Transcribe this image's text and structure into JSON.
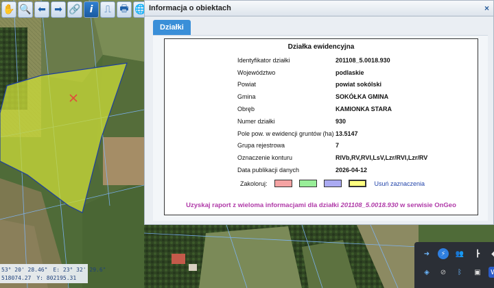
{
  "toolbar": {
    "buttons": [
      {
        "name": "pan-hand-icon",
        "glyph": "✋"
      },
      {
        "name": "zoom-icon",
        "glyph": "🔍"
      },
      {
        "name": "back-arrow-icon",
        "glyph": "⬅"
      },
      {
        "name": "forward-arrow-icon",
        "glyph": "➡"
      },
      {
        "name": "link-icon",
        "glyph": "🔗"
      },
      {
        "name": "info-icon",
        "glyph": "i"
      },
      {
        "name": "measure-icon",
        "glyph": "⎍"
      },
      {
        "name": "print-icon",
        "glyph": "🖶"
      },
      {
        "name": "globe-icon",
        "glyph": "🌐"
      }
    ]
  },
  "dialog": {
    "title": "Informacja o obiektach",
    "close": "×",
    "tab": "Działki",
    "header": "Działka ewidencyjna",
    "rows": [
      {
        "label": "Identyfikator działki",
        "value": "201108_5.0018.930"
      },
      {
        "label": "Województwo",
        "value": "podlaskie"
      },
      {
        "label": "Powiat",
        "value": "powiat sokólski"
      },
      {
        "label": "Gmina",
        "value": "SOKÓŁKA GMINA"
      },
      {
        "label": "Obręb",
        "value": "KAMIONKA STARA"
      },
      {
        "label": "Numer działki",
        "value": "930"
      },
      {
        "label": "Pole pow. w ewidencji gruntów (ha)",
        "value": "13.5147"
      },
      {
        "label": "Grupa rejestrowa",
        "value": "7"
      },
      {
        "label": "Oznaczenie konturu",
        "value": "RIVb,RV,RVI,LsV,Lzr/RVI,Lzr/RV"
      },
      {
        "label": "Data publikacji danych",
        "value": "2026-04-12"
      }
    ],
    "colour_label": "Zakoloruj:",
    "swatches": [
      "#f5a3a3",
      "#98ee98",
      "#aaaaf2",
      "#ffff80"
    ],
    "clear_link": "Usuń zaznaczenia",
    "report_prefix": "Uzyskaj raport z wieloma informacjami dla działki ",
    "report_id": "201108_5.0018.930",
    "report_suffix": " w serwisie OnGeo"
  },
  "coords": {
    "lat_dms": "53° 20' 28.46\"",
    "lon_dms": "E: 23° 32' 29.6\"",
    "x": "518074.27",
    "y": "Y: 802195.31"
  },
  "tray": {
    "icons": [
      "arrow-icon",
      "bolt-icon",
      "people-icon",
      "pin-icon",
      "shield-icon",
      "bluetooth-icon",
      "users-icon",
      "word-icon",
      "dropbox-icon",
      "wifi-off-icon",
      "camera-icon"
    ]
  },
  "colors": {
    "accent": "#3a8fd8",
    "report_link": "#b03aa8",
    "parcel_fill": "#c8d838"
  }
}
